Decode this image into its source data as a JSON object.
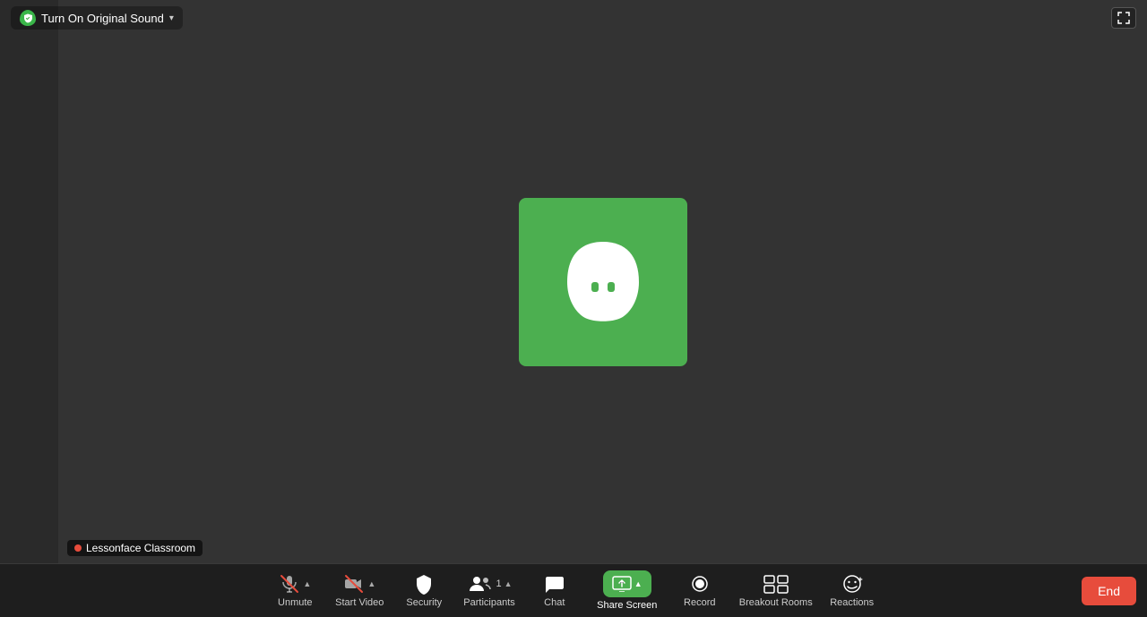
{
  "topbar": {
    "original_sound_label": "Turn On Original Sound",
    "fullscreen_icon": "⛶"
  },
  "main": {
    "background_color": "#333333",
    "avatar_bg": "#4caf50"
  },
  "nametag": {
    "label": "Lessonface Classroom"
  },
  "toolbar": {
    "unmute_label": "Unmute",
    "start_video_label": "Start Video",
    "security_label": "Security",
    "participants_label": "Participants",
    "participants_count": "1",
    "chat_label": "Chat",
    "share_screen_label": "Share Screen",
    "record_label": "Record",
    "breakout_rooms_label": "Breakout Rooms",
    "reactions_label": "Reactions",
    "end_label": "End"
  }
}
